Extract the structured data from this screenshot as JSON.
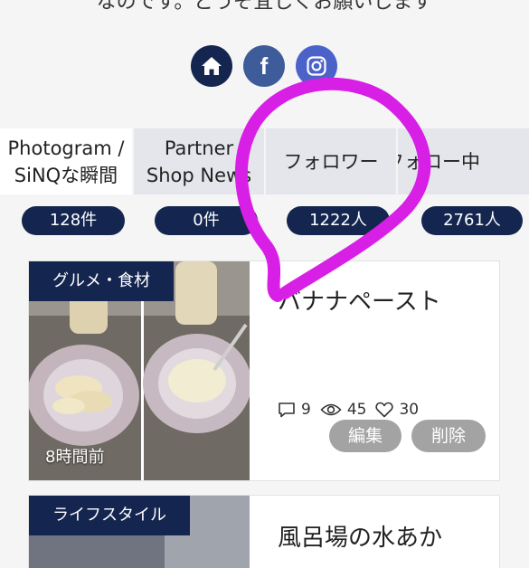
{
  "intro_text": "なのです。どうぞ宜しくお願いします",
  "social": {
    "home_icon": "home-icon",
    "facebook_icon": "facebook-icon",
    "instagram_icon": "instagram-icon",
    "facebook_glyph": "f"
  },
  "tabs": [
    {
      "line1": "Photogram /",
      "line2": "SiNQな瞬間",
      "active": true
    },
    {
      "line1": "Partner",
      "line2": "Shop News",
      "active": false
    },
    {
      "line1": "フォロワー",
      "line2": "",
      "active": false
    },
    {
      "line1": "フォロー中",
      "line2": "",
      "active": false
    }
  ],
  "counts": [
    "128件",
    "0件",
    "1222人",
    "2761人"
  ],
  "posts": [
    {
      "category": "グルメ・食材",
      "time": "8時間前",
      "title": "バナナペースト",
      "comments": "9",
      "views": "45",
      "likes": "30",
      "edit_label": "編集",
      "delete_label": "削除"
    },
    {
      "category": "ライフスタイル",
      "title": "風呂場の水あか"
    }
  ],
  "colors": {
    "navy": "#14264f",
    "facebook": "#3f5c9a",
    "instagram": "#4b63c9",
    "tab_inactive": "#e4e6ec",
    "button_gray": "#a3a3a3",
    "annotation_magenta": "#d81fe6"
  }
}
